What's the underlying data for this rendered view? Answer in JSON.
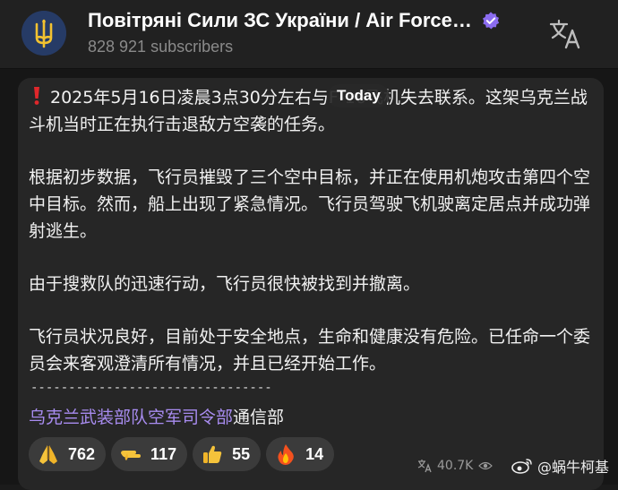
{
  "header": {
    "channel_title": "Повітряні Сили ЗС України / Air Force…",
    "subscribers": "828 921 subscribers",
    "verified_icon": "verified-badge-icon",
    "translate_icon": "translate-icon"
  },
  "date_pill": "Today",
  "post": {
    "alert_icon": "exclamation-icon",
    "paragraphs": [
      "2025年5月16日凌晨3点30分左右与F-16飞机失去联系。这架乌克兰战斗机当时正在执行击退敌方空袭的任务。",
      "根据初步数据，飞行员摧毁了三个空中目标，并正在使用机炮攻击第四个空中目标。然而，船上出现了紧急情况。飞行员驾驶飞机驶离定居点并成功弹射逃生。",
      "由于搜救队的迅速行动，飞行员很快被找到并撤离。",
      "飞行员状况良好，目前处于安全地点，生命和健康没有危险。已任命一个委员会来客观澄清所有情况，并且已经开始工作。"
    ],
    "divider": "--------------------------------",
    "signature_link": "乌克兰武装部队空军司令部",
    "signature_suffix": "通信部"
  },
  "reactions": [
    {
      "icon": "folded-hands-icon",
      "count": "762"
    },
    {
      "icon": "pointing-hand-icon",
      "count": "117"
    },
    {
      "icon": "thumbs-up-icon",
      "count": "55"
    },
    {
      "icon": "fire-icon",
      "count": "14"
    }
  ],
  "meta": {
    "translate_icon": "translate-small-icon",
    "views": "40.7K",
    "views_icon": "eye-icon"
  },
  "watermark": {
    "logo": "weibo-logo-icon",
    "text": "@蜗牛柯基"
  },
  "colors": {
    "link": "#a88cf0",
    "verified": "#8b6cf0",
    "alert": "#e0272b",
    "reaction_bg": "#3b3b3b"
  }
}
